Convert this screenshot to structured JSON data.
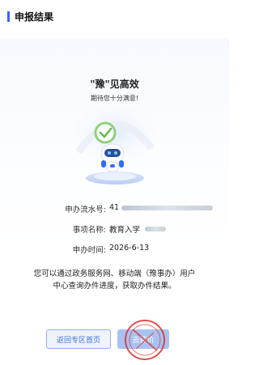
{
  "section": {
    "title": "申报结果"
  },
  "result": {
    "slogan": "\"豫\"见高效",
    "subslogan": "期待您十分满意!"
  },
  "info": {
    "serial_label": "申办流水号:",
    "serial_value": "41",
    "item_label": "事项名称:",
    "item_value": "教育入学",
    "time_label": "申办时间:",
    "time_value": "2026-6-13"
  },
  "notice": {
    "line1": "您可以通过政务服务网、移动端（豫事办）用户",
    "line2": "中心查询办件进度，获取办件结果。"
  },
  "buttons": {
    "back_label": "返回专区首页",
    "evaluate_label": "去评价"
  },
  "colors": {
    "accent": "#2f6bff",
    "stamp": "#d9342b"
  }
}
